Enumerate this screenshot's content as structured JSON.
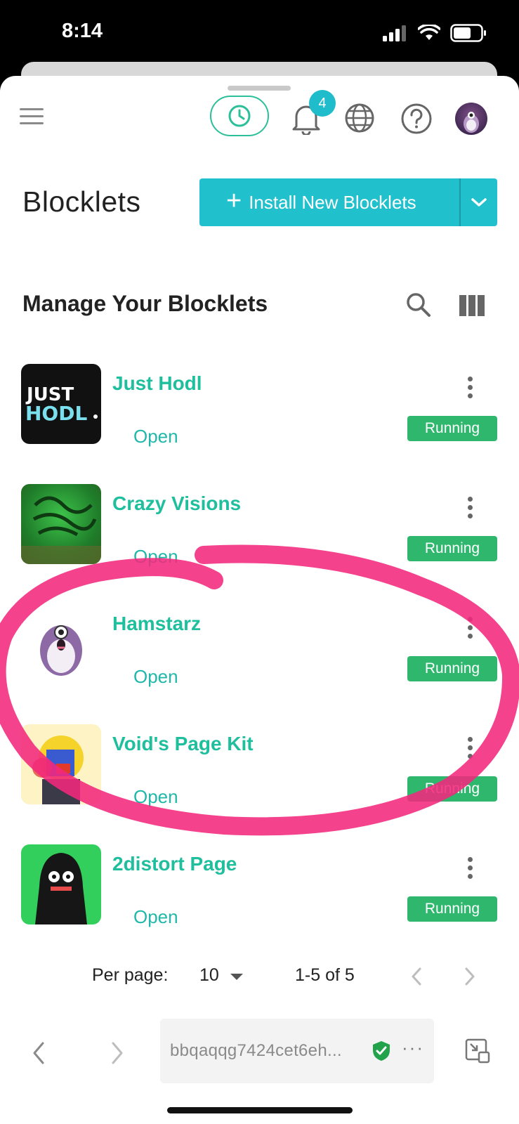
{
  "status_bar": {
    "time": "8:14"
  },
  "header": {
    "notification_count": "4"
  },
  "page": {
    "title": "Blocklets",
    "install_button_label": "Install New Blocklets"
  },
  "section": {
    "title": "Manage Your Blocklets"
  },
  "blocklets": [
    {
      "name": "Just Hodl",
      "action": "Open",
      "status": "Running",
      "logo_text_1": "JUST",
      "logo_text_2": "HODL"
    },
    {
      "name": "Crazy Visions",
      "action": "Open",
      "status": "Running"
    },
    {
      "name": "Hamstarz",
      "action": "Open",
      "status": "Running"
    },
    {
      "name": "Void's Page Kit",
      "action": "Open",
      "status": "Running"
    },
    {
      "name": "2distort Page",
      "action": "Open",
      "status": "Running"
    }
  ],
  "pagination": {
    "per_page_label": "Per page:",
    "per_page_value": "10",
    "range_text": "1-5 of 5"
  },
  "browser": {
    "url": "bbqaqqg7424cet6eh..."
  },
  "colors": {
    "accent_teal": "#21c0cd",
    "name_green": "#1fbf9e",
    "running_green": "#2fb86d",
    "annotation_pink": "#f2287d"
  }
}
